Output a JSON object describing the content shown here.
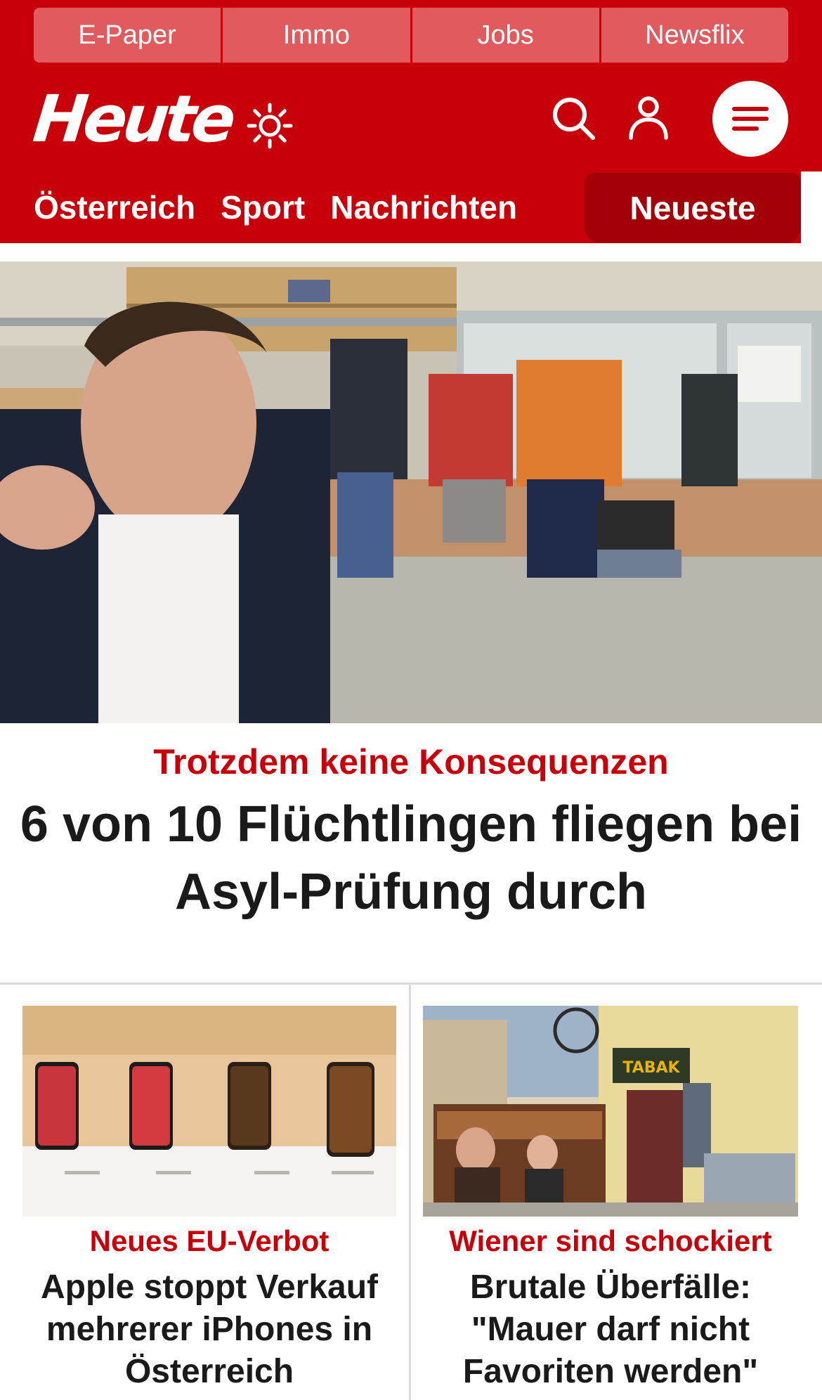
{
  "colors": {
    "brand_red": "#c8000a",
    "tab_dark_red": "#a30008",
    "topnav_pink": "#e05a5e",
    "headline_text": "#1a1a1a"
  },
  "top_nav": [
    "E-Paper",
    "Immo",
    "Jobs",
    "Newsflix"
  ],
  "header": {
    "logo": "Heute",
    "icons": [
      "sun-icon",
      "search-icon",
      "user-icon",
      "menu-icon"
    ]
  },
  "section_nav": {
    "items": [
      "Österreich",
      "Sport",
      "Nachrichten"
    ],
    "active": "Neueste"
  },
  "hero": {
    "kicker": "Trotzdem keine Konsequenzen",
    "headline": "6 von 10 Flüchtlingen fliegen bei Asyl-Prüfung durch"
  },
  "teasers": [
    {
      "kicker": "Neues EU-Verbot",
      "headline": "Apple stoppt Verkauf mehrerer iPhones in Österreich"
    },
    {
      "kicker": "Wiener sind schockiert",
      "headline": "Brutale Überfälle: \"Mauer darf nicht Favoriten werden\"",
      "image_sign": "TABAK"
    }
  ]
}
